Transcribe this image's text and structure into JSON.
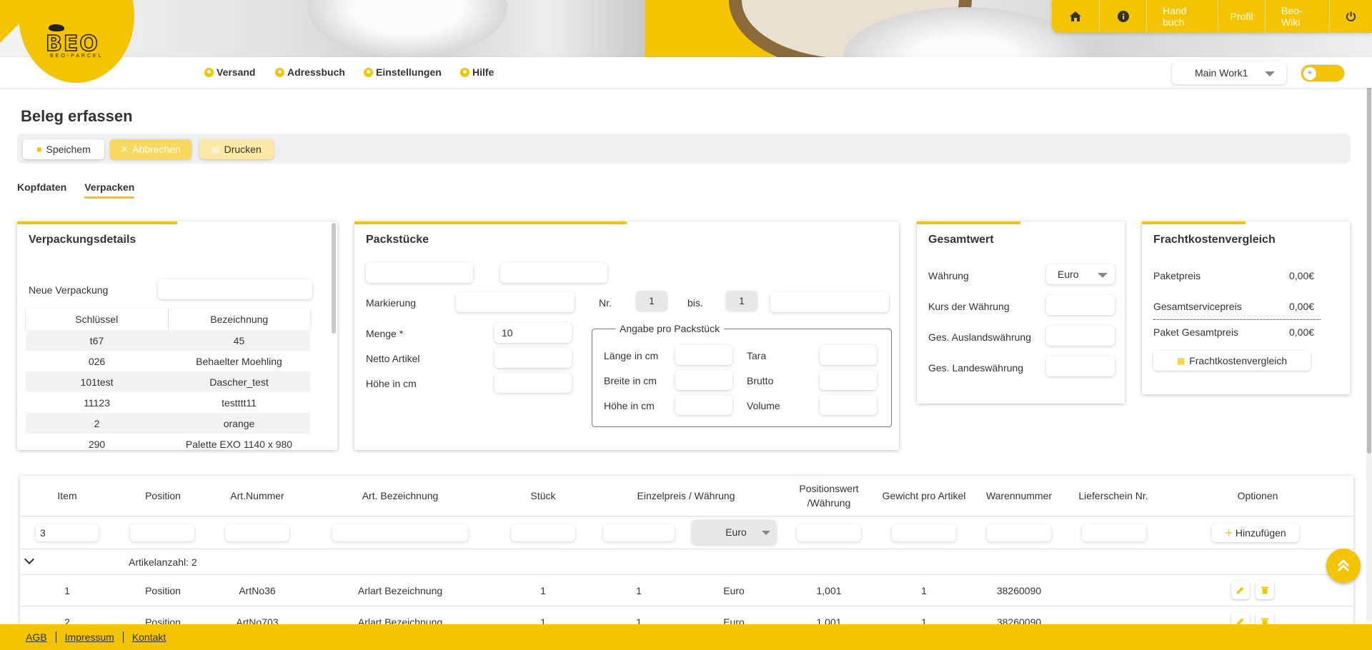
{
  "brand": {
    "logo_text": "BEO",
    "logo_sub": "BEO-PARCEL"
  },
  "topnav": {
    "home_icon": "home-icon",
    "info_icon": "info-icon",
    "handbuch": "Hand buch",
    "profil": "Profil",
    "wiki": "Beo-Wiki",
    "power_icon": "power-icon"
  },
  "mainnav": {
    "items": [
      "Versand",
      "Adressbuch",
      "Einstellungen",
      "Hilfe"
    ],
    "workspace": "Main Work1"
  },
  "page": {
    "title": "Beleg erfassen"
  },
  "toolbar": {
    "save": "Speichem",
    "cancel": "Abbrechen",
    "print": "Drucken"
  },
  "tabs": [
    "Kopfdaten",
    "Verpacken"
  ],
  "verpackung": {
    "title": "Verpackungsdetails",
    "neue_label": "Neue Verpackung",
    "columns": [
      "Schlüssel",
      "Bezeichnung"
    ],
    "rows": [
      [
        "t67",
        "45"
      ],
      [
        "026",
        "Behaelter Moehling"
      ],
      [
        "101test",
        "Dascher_test"
      ],
      [
        "11123",
        "testttt11"
      ],
      [
        "2",
        "orange"
      ],
      [
        "290",
        "Palette EXO 1140 x 980"
      ]
    ]
  },
  "packstuecke": {
    "title": "Packstücke",
    "markierung": "Markierung",
    "nr": "Nr.",
    "nr_from": "1",
    "bis": "bis.",
    "nr_to": "1",
    "menge": "Menge *",
    "menge_value": "10",
    "netto": "Netto Artikel",
    "hoehe": "Höhe in cm",
    "fieldset_legend": "Angabe pro Packstück",
    "laenge": "Länge in cm",
    "breite": "Breite in cm",
    "hoehe2": "Höhe in cm",
    "tara": "Tara",
    "brutto": "Brutto",
    "volume": "Volume"
  },
  "gesamtwert": {
    "title": "Gesamtwert",
    "waehrung": "Währung",
    "waehrung_value": "Euro",
    "kurs": "Kurs der Währung",
    "ausland": "Ges. Auslandswährung",
    "landes": "Ges. Landeswährung"
  },
  "fracht": {
    "title": "Frachtkostenvergleich",
    "paketpreis": "Paketpreis",
    "paketpreis_value": "0,00€",
    "service": "Gesamtservicepreis",
    "service_value": "0,00€",
    "gesamt": "Paket Gesamtpreis",
    "gesamt_value": "0,00€",
    "button": "Frachtkostenvergleich"
  },
  "grid": {
    "columns": [
      "Item",
      "Position",
      "Art.Nummer",
      "Art. Bezeichnung",
      "Stück",
      "Einzelpreis / Währung",
      "Positionswert",
      "/Währung",
      "Gewicht pro Artikel",
      "Warennummer",
      "Lieferschein Nr.",
      "Optionen"
    ],
    "input_item": "3",
    "input_currency": "Euro",
    "add_button": "Hinzufügen",
    "group_label": "Artikelanzahl: 2",
    "rows": [
      [
        "1",
        "Position",
        "ArtNo36",
        "Arlart Bezeichnung",
        "1",
        "1",
        "Euro",
        "1,001",
        "1",
        "38260090"
      ],
      [
        "2",
        "Position",
        "ArtNo703",
        "Arlart Bezeichnung",
        "1",
        "1",
        "Euro",
        "1,001",
        "1",
        "38260090"
      ]
    ]
  },
  "footer": {
    "links": [
      "AGB",
      "Impressum",
      "Kontakt"
    ]
  },
  "colors": {
    "accent": "#f5c400"
  }
}
